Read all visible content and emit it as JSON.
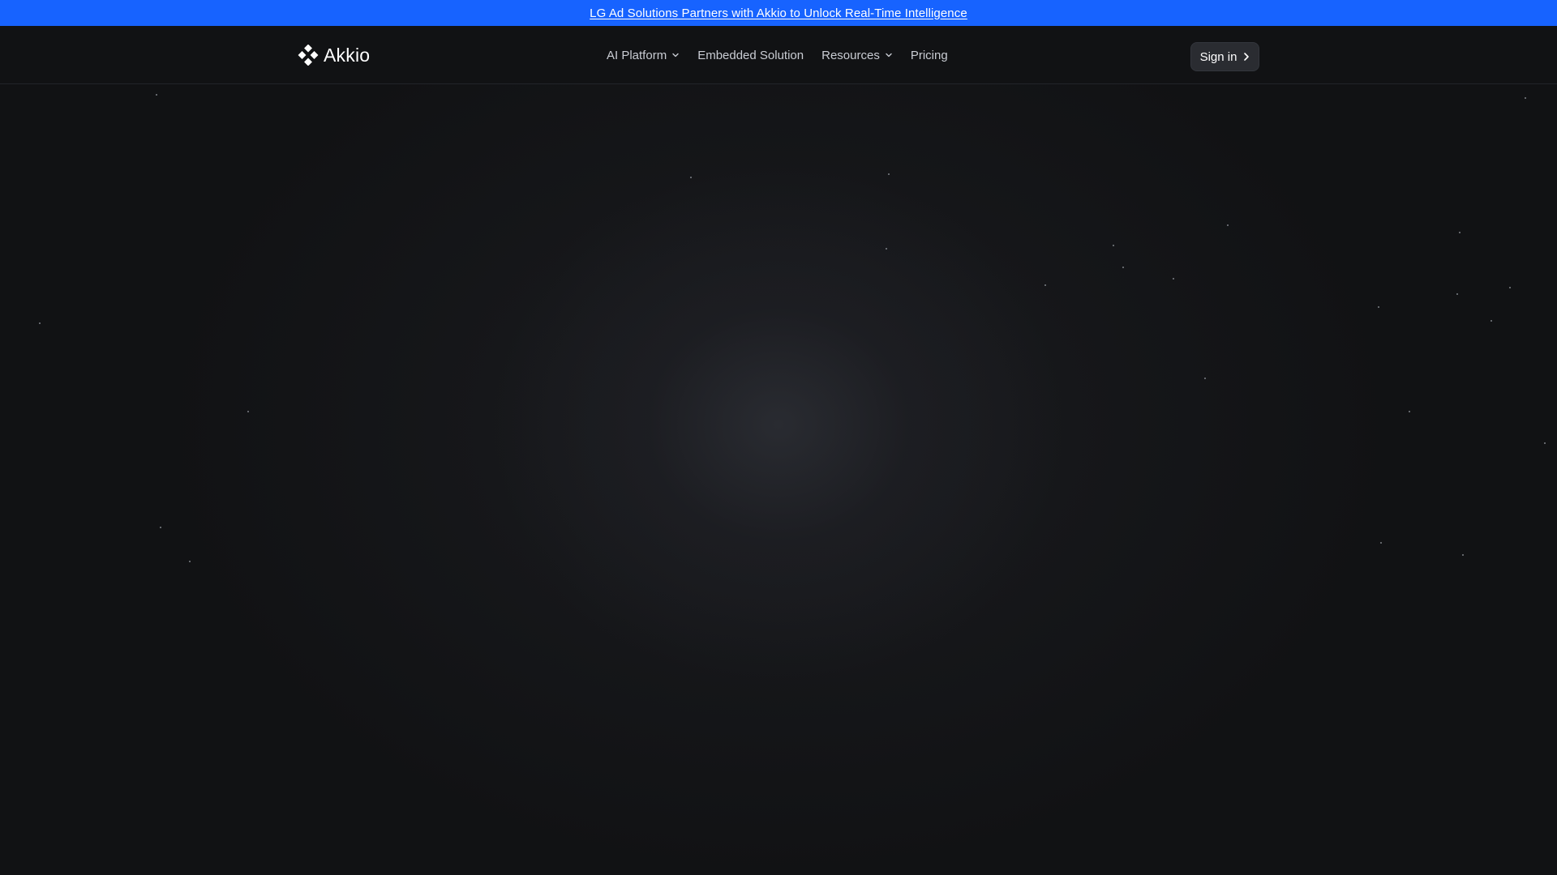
{
  "announcement": {
    "text": "LG Ad Solutions Partners with Akkio to Unlock Real-Time Intelligence"
  },
  "brand": {
    "name": "Akkio",
    "logo_icon": "akkio-diamond-logo-icon"
  },
  "nav": {
    "items": [
      {
        "label": "AI Platform",
        "has_dropdown": true
      },
      {
        "label": "Embedded Solution",
        "has_dropdown": false
      },
      {
        "label": "Resources",
        "has_dropdown": true
      },
      {
        "label": "Pricing",
        "has_dropdown": false
      }
    ]
  },
  "header": {
    "sign_in_label": "Sign in"
  },
  "colors": {
    "announcement_bg": "#1763ff",
    "page_bg": "#111214",
    "button_bg": "#2a2c31",
    "text_primary": "#ffffff",
    "text_nav": "#c9ccd3"
  }
}
